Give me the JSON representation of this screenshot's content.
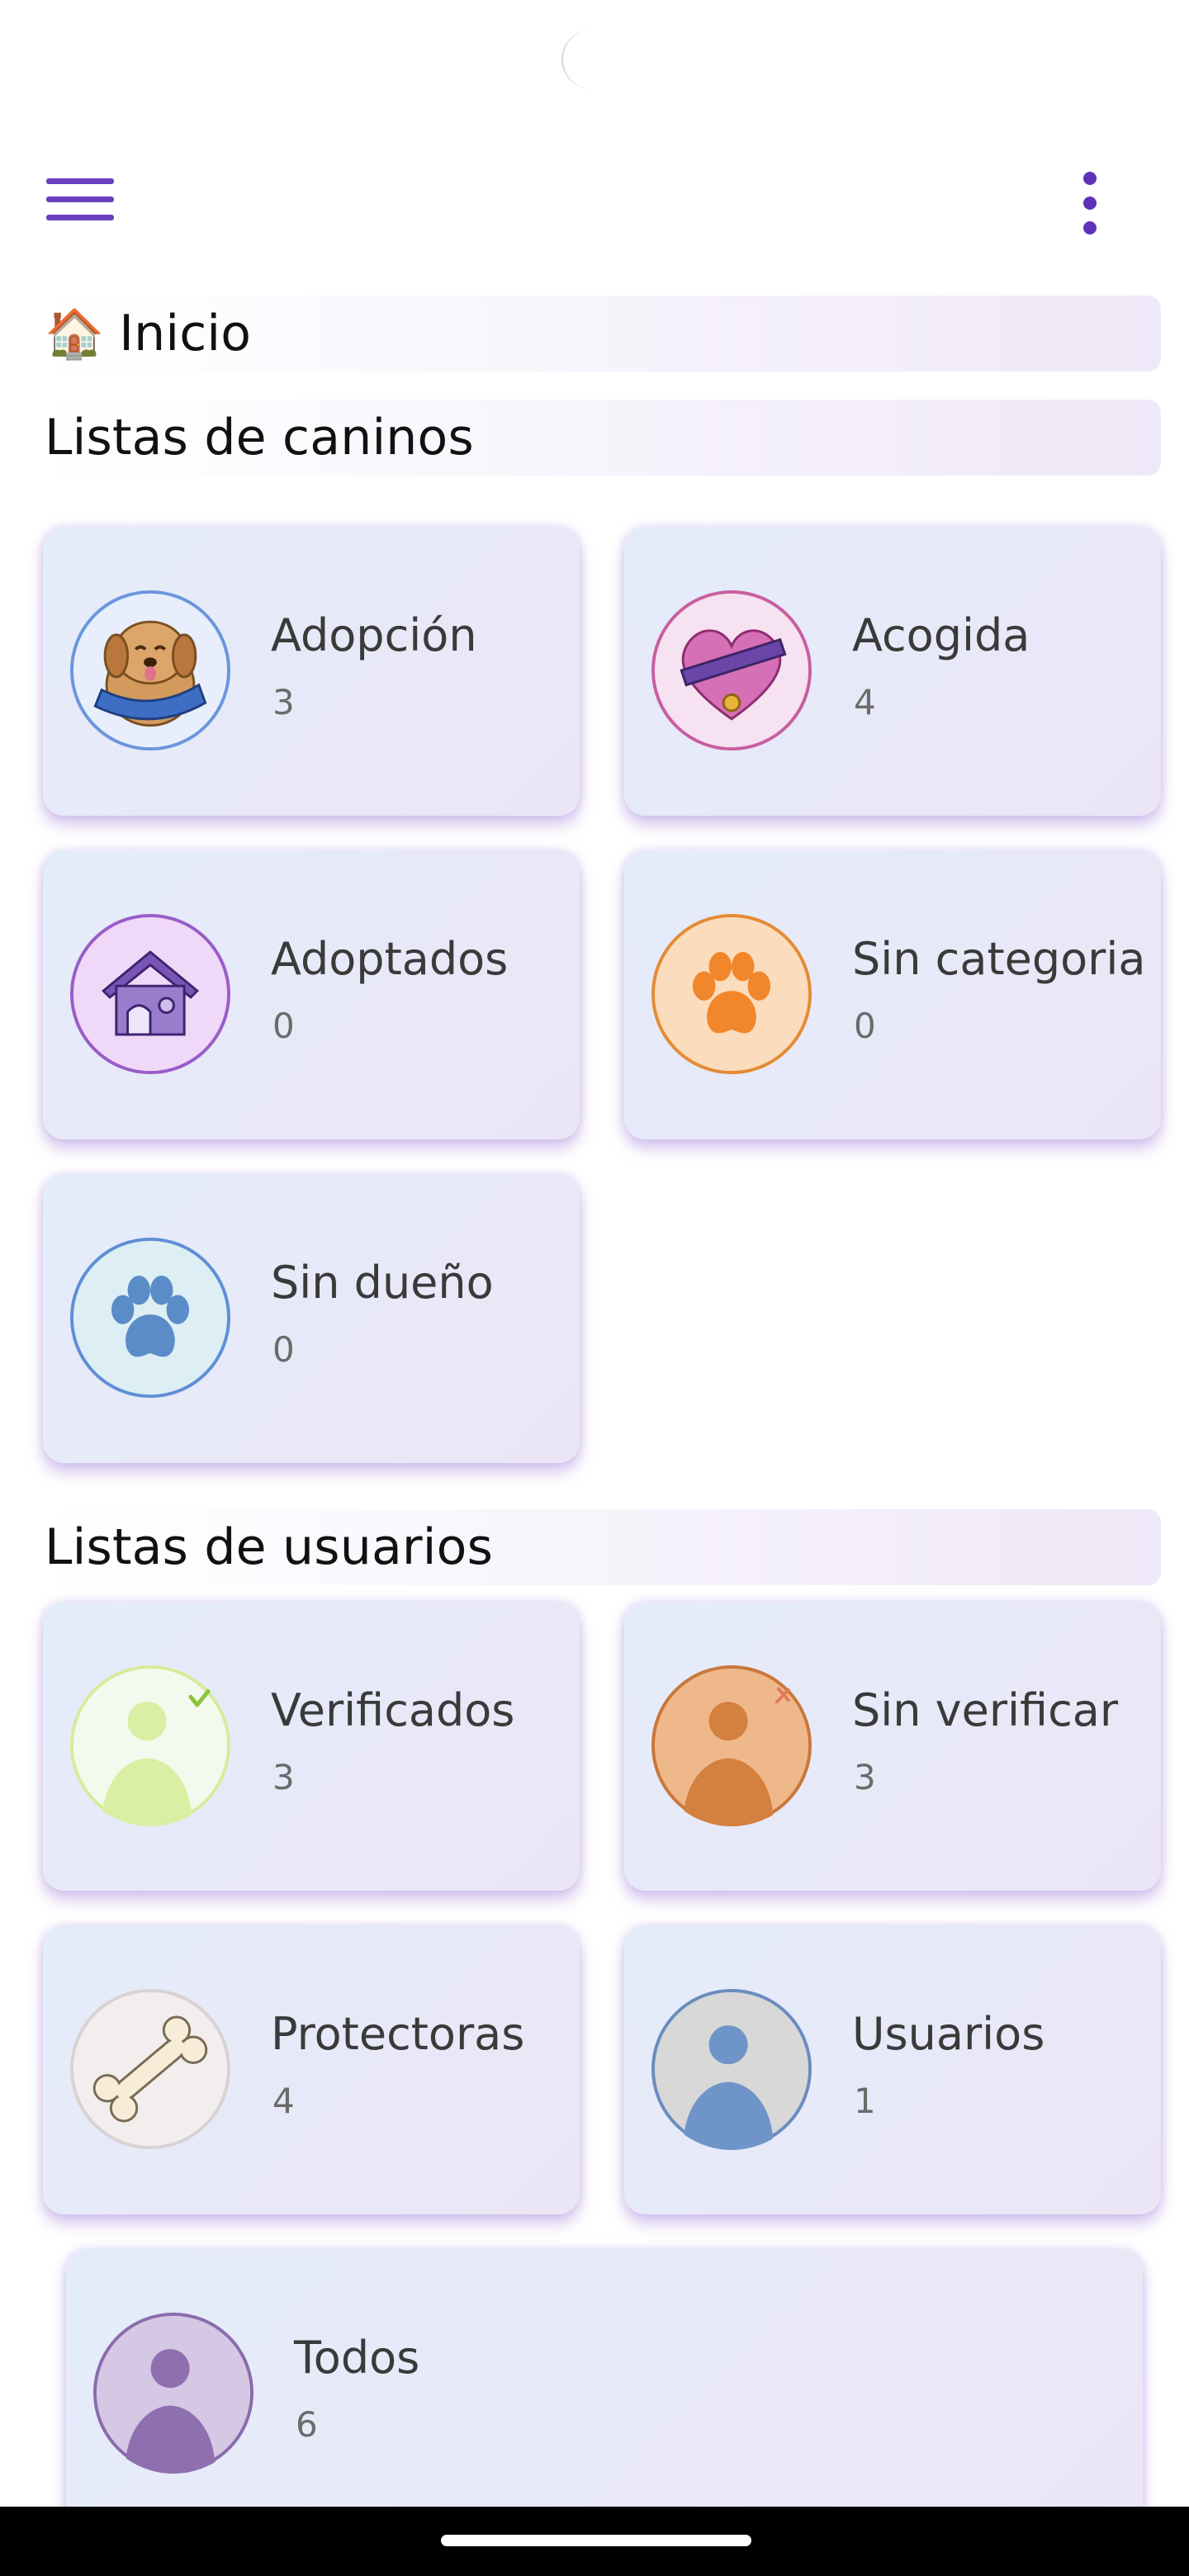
{
  "header": {
    "title_emoji": "🏠",
    "title": "Inicio",
    "menu_icon": "hamburger-icon",
    "more_icon": "kebab-vertical-icon",
    "accent_color": "#6a3fc0"
  },
  "dog_section": {
    "title": "Listas de caninos",
    "cards": [
      {
        "label": "Adopción",
        "count": "3",
        "icon": "dog-with-scarf-icon"
      },
      {
        "label": "Acogida",
        "count": "4",
        "icon": "heart-collar-icon"
      },
      {
        "label": "Adoptados",
        "count": "0",
        "icon": "dog-house-icon"
      },
      {
        "label": "Sin categoria",
        "count": "0",
        "icon": "orange-paw-icon"
      },
      {
        "label": "Sin dueño",
        "count": "0",
        "icon": "blue-paw-icon"
      }
    ]
  },
  "user_section": {
    "title": "Listas de usuarios",
    "cards": [
      {
        "label": "Verificados",
        "count": "3",
        "icon": "verified-user-icon"
      },
      {
        "label": "Sin verificar",
        "count": "3",
        "icon": "unverified-user-icon"
      },
      {
        "label": "Protectoras",
        "count": "4",
        "icon": "bone-icon"
      },
      {
        "label": "Usuarios",
        "count": "1",
        "icon": "user-icon"
      },
      {
        "label": "Todos",
        "count": "6",
        "icon": "all-users-icon"
      }
    ]
  }
}
